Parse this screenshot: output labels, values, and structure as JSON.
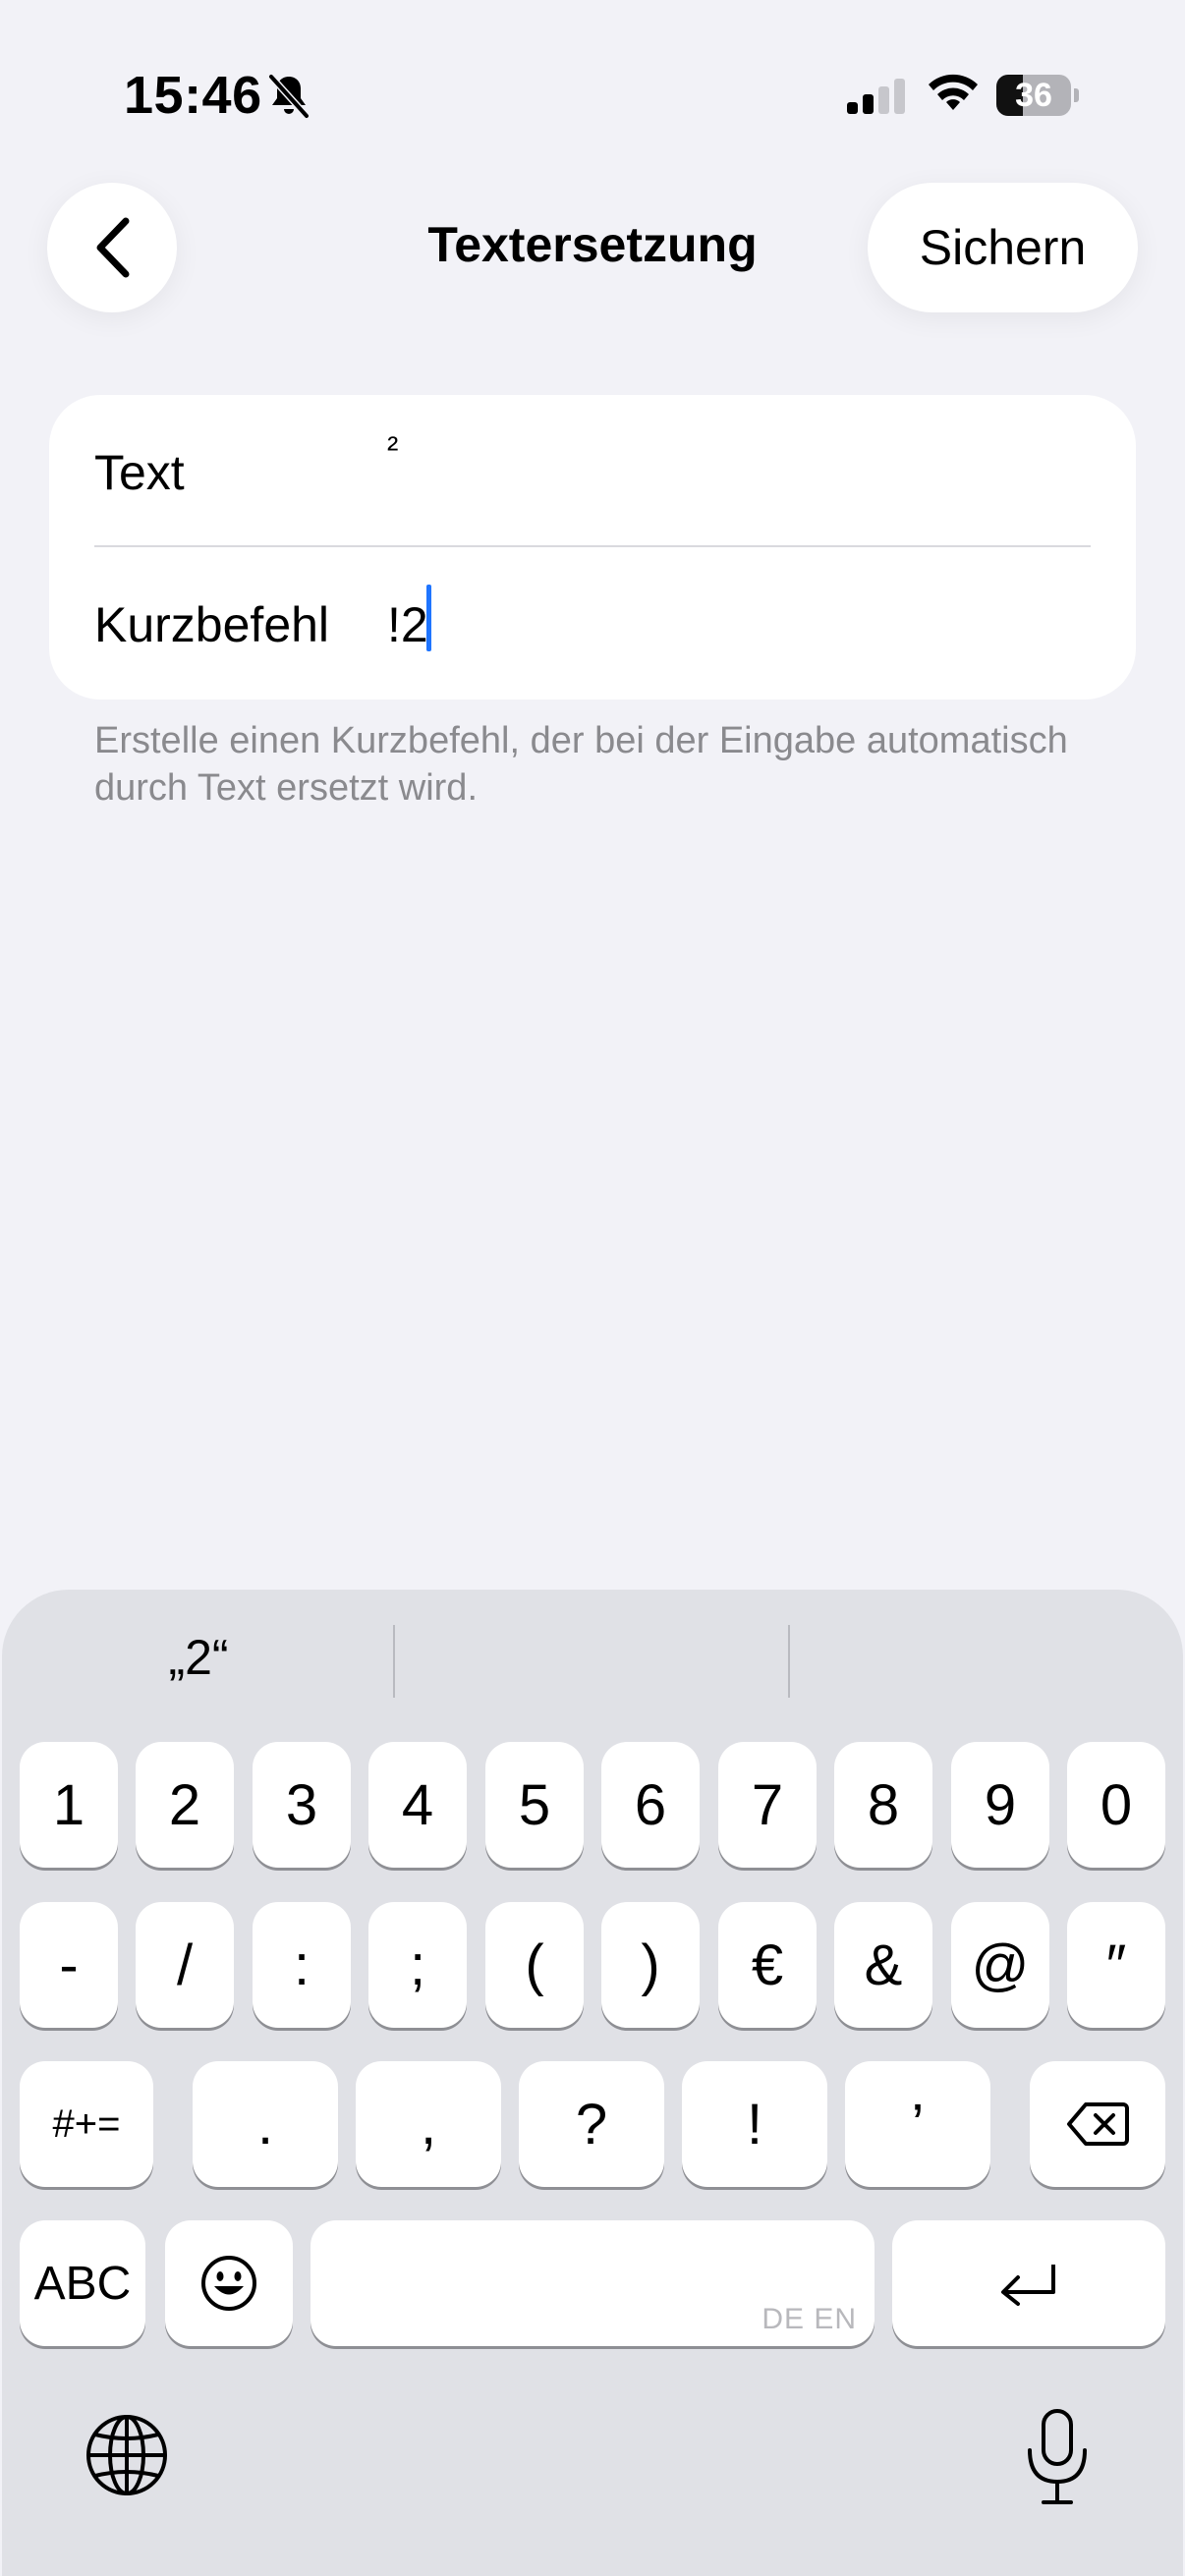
{
  "status_bar": {
    "time": "15:46",
    "battery": "36",
    "battery_level": 0.36,
    "icons": [
      "bell-slash-icon",
      "cellular-signal-icon",
      "wifi-icon",
      "battery-icon"
    ]
  },
  "nav": {
    "back_icon": "chevron-left-icon",
    "title": "Textersetzung",
    "save_label": "Sichern"
  },
  "form": {
    "text_label": "Text",
    "text_value": "²",
    "shortcut_label": "Kurzbefehl",
    "shortcut_value": "!2"
  },
  "help_text": "Erstelle einen Kurzbefehl, der bei der Eingabe automatisch durch Text ersetzt wird.",
  "keyboard": {
    "suggestions": [
      "„2“",
      "",
      ""
    ],
    "row1": [
      "1",
      "2",
      "3",
      "4",
      "5",
      "6",
      "7",
      "8",
      "9",
      "0"
    ],
    "row2": [
      "-",
      "/",
      ":",
      ";",
      "(",
      ")",
      "€",
      "&",
      "@",
      "″"
    ],
    "row3": {
      "more_symbols": "#+=",
      "keys": [
        ".",
        ",",
        "?",
        "!",
        "’"
      ],
      "delete_icon": "delete-backward-icon"
    },
    "row4": {
      "abc": "ABC",
      "emoji_icon": "emoji-icon",
      "space_hint": "DE EN",
      "return_icon": "return-icon"
    },
    "bottom": {
      "globe_icon": "globe-icon",
      "mic_icon": "microphone-icon"
    }
  }
}
